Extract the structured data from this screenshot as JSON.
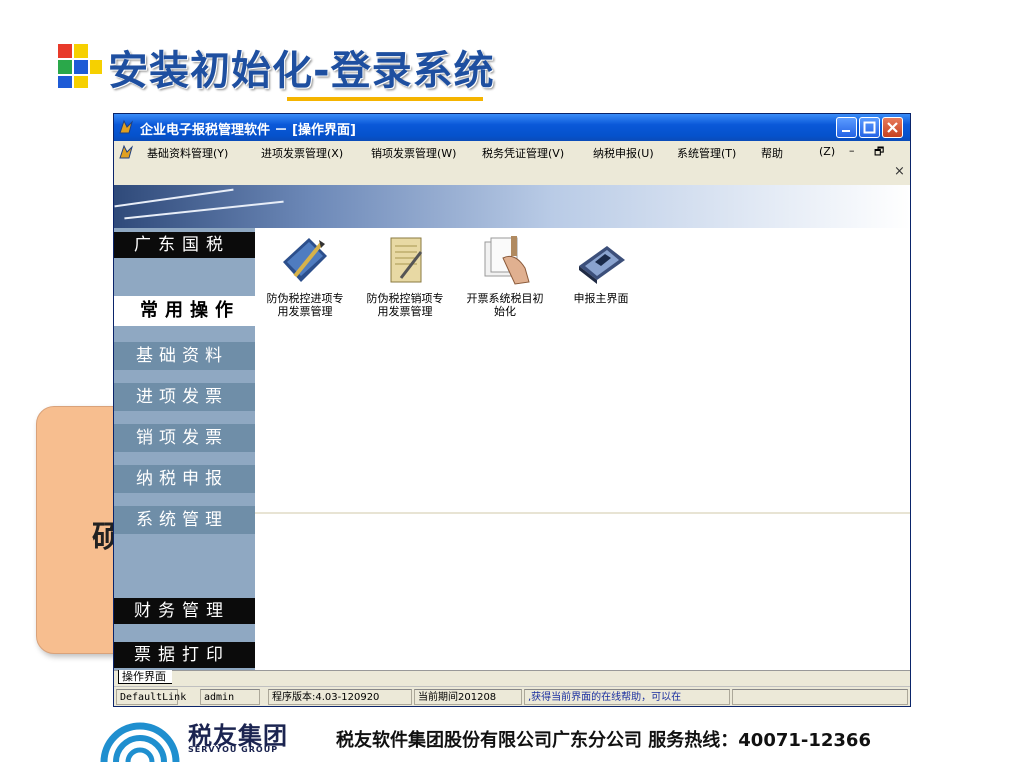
{
  "slide": {
    "title": "安装初始化-登录系统",
    "callout_char": "硕"
  },
  "window": {
    "title": "企业电子报税管理软件 － [操作界面]",
    "menus": [
      "基础资料管理(Y)",
      "进项发票管理(X)",
      "销项发票管理(W)",
      "税务凭证管理(V)",
      "纳税申报(U)",
      "系统管理(T)",
      "帮助",
      "(Z)"
    ],
    "mdi_minimize": "–",
    "mdi_restore": "🗗",
    "mdi_close": "×"
  },
  "sidebar": {
    "region": "广东国税",
    "selected": "常用操作",
    "items": [
      "基础资料",
      "进项发票",
      "销项发票",
      "纳税申报",
      "系统管理"
    ],
    "bottom": [
      "财务管理",
      "票据打印"
    ]
  },
  "tiles": [
    {
      "label1": "防伪税控进项专",
      "label2": "用发票管理",
      "icon": "pen-document-icon"
    },
    {
      "label1": "防伪税控销项专",
      "label2": "用发票管理",
      "icon": "notepad-pencil-icon"
    },
    {
      "label1": "开票系统税目初",
      "label2": "始化",
      "icon": "hand-papers-icon"
    },
    {
      "label1": "申报主界面",
      "label2": "",
      "icon": "floppy-disk-icon"
    }
  ],
  "tab": "操作界面",
  "status": {
    "link": "DefaultLink",
    "user": "admin",
    "version": "程序版本:4.03-120920",
    "period": "当前期间201208",
    "help": ",获得当前界面的在线帮助，可以在"
  },
  "footer": {
    "brand": "税友集团",
    "brand_en": "SERVYOU GROUP",
    "text": "税友软件集团股份有限公司广东分公司   服务热线：40071-12366"
  },
  "colors": {
    "title_blue": "#1e4fa0",
    "accent_yellow": "#f5b400",
    "callout": "#f7be8f",
    "sidebar": "#8fa8c2",
    "titlebar": "#0a58d8"
  }
}
